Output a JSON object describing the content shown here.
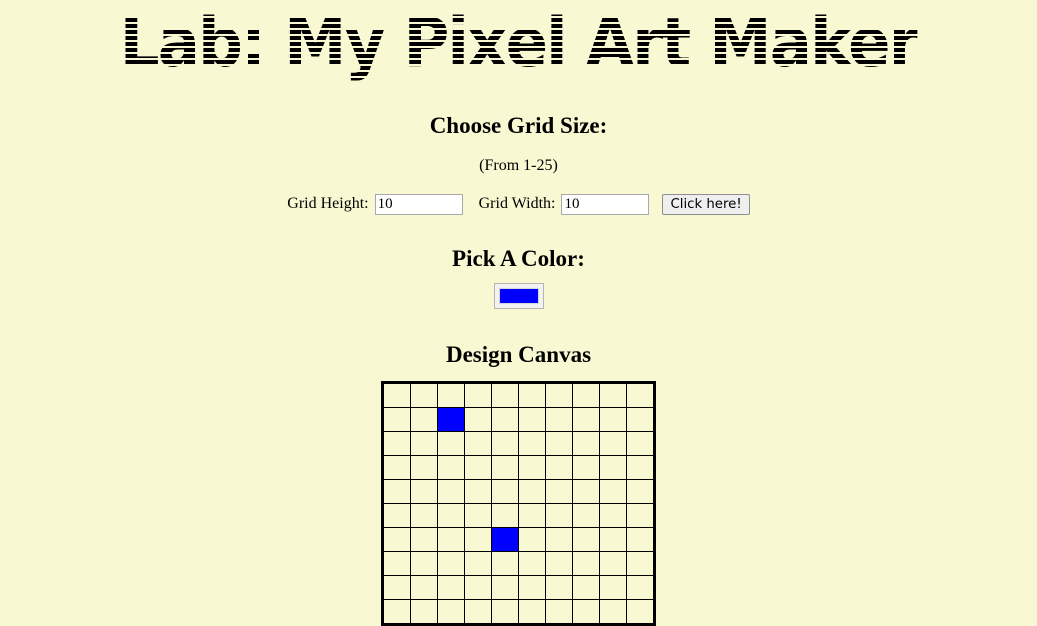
{
  "page": {
    "title": "Lab: My Pixel Art Maker",
    "background_color": "#F8F8D2"
  },
  "grid_size_section": {
    "heading": "Choose Grid Size:",
    "note": "(From 1-25)",
    "height_label": "Grid Height:",
    "height_value": "10",
    "width_label": "Grid Width:",
    "width_value": "10",
    "submit_label": "Click here!"
  },
  "color_section": {
    "heading": "Pick A Color:",
    "selected_color": "#0000FF"
  },
  "canvas_section": {
    "heading": "Design Canvas",
    "rows": 10,
    "cols": 10,
    "cell_background": "#F8F8D2",
    "border_color": "#000000",
    "filled_cells": [
      {
        "row": 2,
        "col": 3,
        "color": "#0000FF"
      },
      {
        "row": 7,
        "col": 5,
        "color": "#0000FF"
      }
    ]
  }
}
